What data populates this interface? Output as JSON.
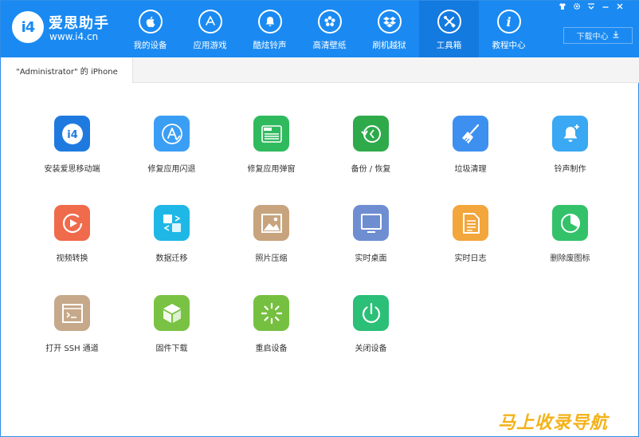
{
  "app": {
    "brand_name": "爱思助手",
    "brand_url": "www.i4.cn",
    "logo_text": "i4",
    "accent": "#1a8af2"
  },
  "nav": [
    {
      "label": "我的设备",
      "icon": "apple-icon",
      "active": false
    },
    {
      "label": "应用游戏",
      "icon": "app-store-icon",
      "active": false
    },
    {
      "label": "酷炫铃声",
      "icon": "bell-icon",
      "active": false
    },
    {
      "label": "高清壁纸",
      "icon": "flower-icon",
      "active": false
    },
    {
      "label": "刷机越狱",
      "icon": "dropbox-icon",
      "active": false
    },
    {
      "label": "工具箱",
      "icon": "tools-icon",
      "active": true
    },
    {
      "label": "教程中心",
      "icon": "info-icon",
      "active": false
    }
  ],
  "window_controls": [
    "shirt-icon",
    "gear-icon",
    "dropdown-icon",
    "minimize-icon",
    "close-icon"
  ],
  "download_center": {
    "label": "下载中心",
    "icon": "download-arrow-icon"
  },
  "device_tab": {
    "label": "\"Administrator\" 的 iPhone"
  },
  "tools": [
    {
      "label": "安装爱思移动端",
      "icon": "i4-mobile-icon",
      "color": "#1f7ae0"
    },
    {
      "label": "修复应用闪退",
      "icon": "app-repair-icon",
      "color": "#3b9ef5"
    },
    {
      "label": "修复应用弹窗",
      "icon": "apple-id-card-icon",
      "color": "#2fba5e"
    },
    {
      "label": "备份 / 恢复",
      "icon": "backup-restore-icon",
      "color": "#2faa4b"
    },
    {
      "label": "垃圾清理",
      "icon": "broom-icon",
      "color": "#3d8ff0"
    },
    {
      "label": "铃声制作",
      "icon": "bell-plus-icon",
      "color": "#3aa8f2"
    },
    {
      "label": "视频转换",
      "icon": "video-play-icon",
      "color": "#f06a4c"
    },
    {
      "label": "数据迁移",
      "icon": "data-transfer-icon",
      "color": "#1fb8e6"
    },
    {
      "label": "照片压缩",
      "icon": "photo-icon",
      "color": "#c7a47e"
    },
    {
      "label": "实时桌面",
      "icon": "monitor-icon",
      "color": "#6f8ed2"
    },
    {
      "label": "实时日志",
      "icon": "document-icon",
      "color": "#f3a63c"
    },
    {
      "label": "删除废图标",
      "icon": "pie-clock-icon",
      "color": "#33c26a"
    },
    {
      "label": "打开 SSH 通道",
      "icon": "terminal-icon",
      "color": "#c6a98a"
    },
    {
      "label": "固件下载",
      "icon": "cube-icon",
      "color": "#79c243"
    },
    {
      "label": "重启设备",
      "icon": "spinner-icon",
      "color": "#76c041"
    },
    {
      "label": "关闭设备",
      "icon": "power-icon",
      "color": "#2bbf78"
    }
  ],
  "watermark": "马上收录导航"
}
